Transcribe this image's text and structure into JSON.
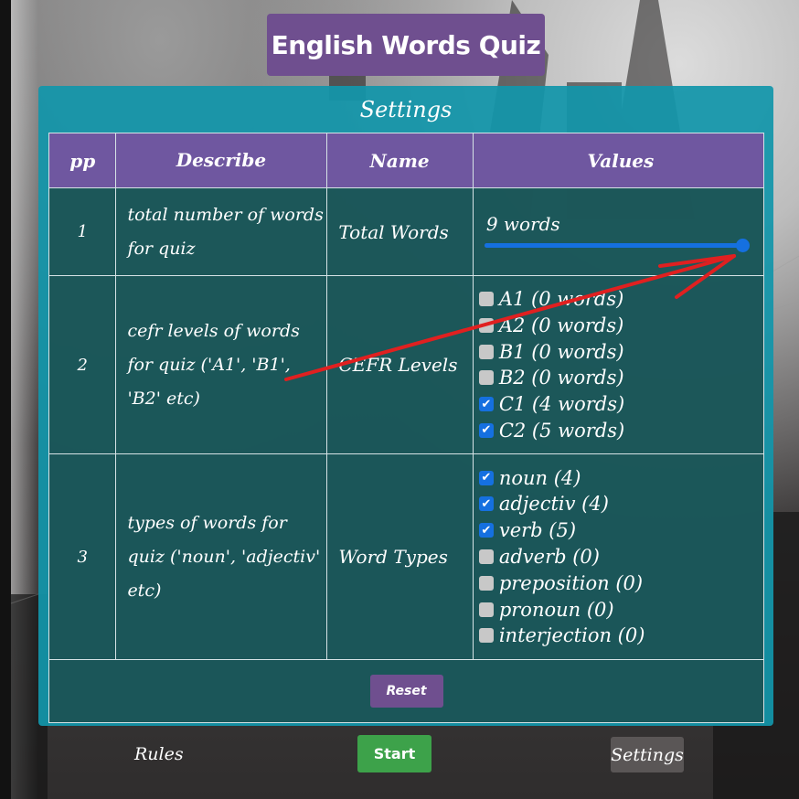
{
  "app": {
    "title": "English Words Quiz"
  },
  "settings": {
    "title": "Settings",
    "headers": {
      "pp": "pp",
      "describe": "Describe",
      "name": "Name",
      "values": "Values"
    },
    "rows": [
      {
        "pp": "1",
        "describe": "total number of words for quiz",
        "name": "Total Words"
      },
      {
        "pp": "2",
        "describe": "cefr levels of words for quiz ('A1', 'B1', 'B2' etc)",
        "name": "CEFR Levels"
      },
      {
        "pp": "3",
        "describe": "types of words for quiz ('noun', 'adjectiv' etc)",
        "name": "Word Types"
      }
    ],
    "total_words": {
      "label": "9 words",
      "value": 9,
      "max": 9,
      "fraction": 1.0
    },
    "cefr_levels": [
      {
        "label": "A1 (0 words)",
        "checked": false
      },
      {
        "label": "A2 (0 words)",
        "checked": false
      },
      {
        "label": "B1 (0 words)",
        "checked": false
      },
      {
        "label": "B2 (0 words)",
        "checked": false
      },
      {
        "label": "C1 (4 words)",
        "checked": true
      },
      {
        "label": "C2 (5 words)",
        "checked": true
      }
    ],
    "word_types": [
      {
        "label": "noun (4)",
        "checked": true
      },
      {
        "label": "adjectiv (4)",
        "checked": true
      },
      {
        "label": "verb (5)",
        "checked": true
      },
      {
        "label": "adverb (0)",
        "checked": false
      },
      {
        "label": "preposition (0)",
        "checked": false
      },
      {
        "label": "pronoun (0)",
        "checked": false
      },
      {
        "label": "interjection (0)",
        "checked": false
      }
    ],
    "reset_label": "Reset"
  },
  "footer": {
    "rules_label": "Rules",
    "start_label": "Start",
    "settings_label": "Settings"
  },
  "colors": {
    "title_bg": "#6f4f8f",
    "panel_bg": "#1296aa",
    "header_bg": "#6f57a0",
    "accent_blue": "#1570e0",
    "start_green": "#3da24a",
    "annotation_red": "#e02020"
  },
  "annotation": {
    "type": "red-arrow",
    "points_to": "total-words-slider-thumb"
  }
}
